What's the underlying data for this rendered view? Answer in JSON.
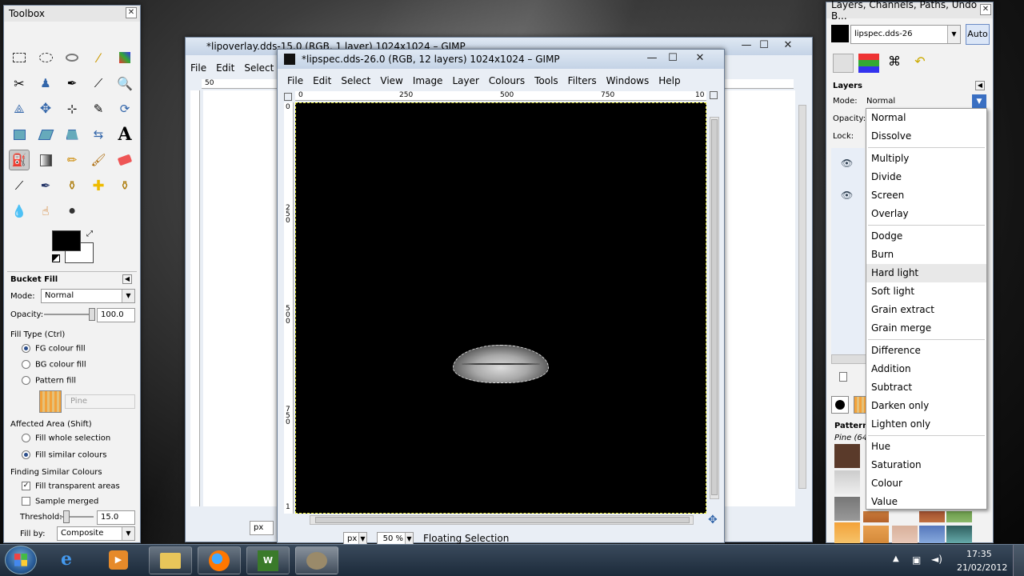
{
  "toolbox": {
    "title": "Toolbox",
    "tool_name": "Bucket Fill",
    "mode_label": "Mode:",
    "mode_value": "Normal",
    "opacity_label": "Opacity:",
    "opacity_value": "100.0",
    "fill_type_label": "Fill Type  (Ctrl)",
    "fill_types": [
      "FG colour fill",
      "BG colour fill",
      "Pattern fill"
    ],
    "pattern_name": "Pine",
    "affected_label": "Affected Area  (Shift)",
    "affected": [
      "Fill whole selection",
      "Fill similar colours"
    ],
    "finding_label": "Finding Similar Colours",
    "fill_transparent": "Fill transparent areas",
    "sample_merged": "Sample merged",
    "threshold_label": "Threshold:",
    "threshold_value": "15.0",
    "fill_by_label": "Fill by:",
    "fill_by_value": "Composite"
  },
  "back_window": {
    "title": "*lipoverlay.dds-15.0 (RGB, 1 layer) 1024x1024 – GIMP",
    "menus": [
      "File",
      "Edit",
      "Select"
    ],
    "ruler_start": "50",
    "unit": "px"
  },
  "main_window": {
    "title": "*lipspec.dds-26.0 (RGB, 12 layers) 1024x1024 – GIMP",
    "menus": [
      "File",
      "Edit",
      "Select",
      "View",
      "Image",
      "Layer",
      "Colours",
      "Tools",
      "Filters",
      "Windows",
      "Help"
    ],
    "ruler_h": [
      "0",
      "250",
      "500",
      "750",
      "10"
    ],
    "ruler_v": [
      "0",
      "2\n5\n0",
      "5\n0\n0",
      "7\n5\n0",
      "1"
    ],
    "unit": "px",
    "zoom": "50 %",
    "status": "Floating Selection"
  },
  "layers_panel": {
    "title": "Layers, Channels, Paths, Undo - B...",
    "image_name": "lipspec.dds-26",
    "auto_label": "Auto",
    "section": "Layers",
    "mode_label": "Mode:",
    "mode_value": "Normal",
    "opacity_label": "Opacity:",
    "lock_label": "Lock:",
    "patterns_label": "Patterns",
    "pattern_name": "Pine (64"
  },
  "mode_menu": {
    "groups": [
      [
        "Normal",
        "Dissolve"
      ],
      [
        "Multiply",
        "Divide",
        "Screen",
        "Overlay"
      ],
      [
        "Dodge",
        "Burn",
        "Hard light",
        "Soft light",
        "Grain extract",
        "Grain merge"
      ],
      [
        "Difference",
        "Addition",
        "Subtract",
        "Darken only",
        "Lighten only"
      ],
      [
        "Hue",
        "Saturation",
        "Colour",
        "Value"
      ]
    ],
    "highlighted": "Hard light"
  },
  "taskbar": {
    "time": "17:35",
    "date": "21/02/2012"
  },
  "colors": {
    "accent": "#2a4d8a",
    "taskbar": "#1c2a3a"
  }
}
